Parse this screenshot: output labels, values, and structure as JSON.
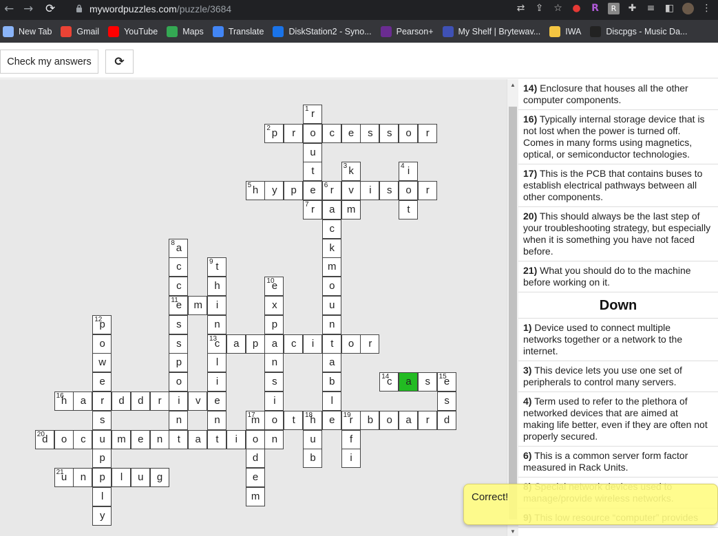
{
  "browser": {
    "url_host": "mywordpuzzles.com",
    "url_path": "/puzzle/3684",
    "bookmarks": [
      {
        "label": "New Tab",
        "color": "#8ab4f8"
      },
      {
        "label": "Gmail",
        "color": "#ea4335"
      },
      {
        "label": "YouTube",
        "color": "#ff0000"
      },
      {
        "label": "Maps",
        "color": "#34a853"
      },
      {
        "label": "Translate",
        "color": "#4285f4"
      },
      {
        "label": "DiskStation2 - Syno...",
        "color": "#1a73e8"
      },
      {
        "label": "Pearson+",
        "color": "#6a2c91"
      },
      {
        "label": "My Shelf | Brytewav...",
        "color": "#3f51b5"
      },
      {
        "label": "IWA",
        "color": "#f4c542"
      },
      {
        "label": "Discpgs - Music Da...",
        "color": "#222222"
      }
    ]
  },
  "toolbar": {
    "check_label": "Check my answers",
    "refresh_icon": "⟳"
  },
  "grid": {
    "highlight_color": "#22bb22",
    "cells": [
      {
        "c": 15,
        "r": 1,
        "l": "r",
        "n": "1"
      },
      {
        "c": 13,
        "r": 2,
        "l": "p",
        "n": "2"
      },
      {
        "c": 14,
        "r": 2,
        "l": "r"
      },
      {
        "c": 15,
        "r": 2,
        "l": "o"
      },
      {
        "c": 16,
        "r": 2,
        "l": "c"
      },
      {
        "c": 17,
        "r": 2,
        "l": "e"
      },
      {
        "c": 18,
        "r": 2,
        "l": "s"
      },
      {
        "c": 19,
        "r": 2,
        "l": "s"
      },
      {
        "c": 20,
        "r": 2,
        "l": "o"
      },
      {
        "c": 21,
        "r": 2,
        "l": "r"
      },
      {
        "c": 15,
        "r": 3,
        "l": "u"
      },
      {
        "c": 15,
        "r": 4,
        "l": "t"
      },
      {
        "c": 17,
        "r": 4,
        "l": "k",
        "n": "3"
      },
      {
        "c": 20,
        "r": 4,
        "l": "i",
        "n": "4"
      },
      {
        "c": 12,
        "r": 5,
        "l": "h",
        "n": "5"
      },
      {
        "c": 13,
        "r": 5,
        "l": "y"
      },
      {
        "c": 14,
        "r": 5,
        "l": "p"
      },
      {
        "c": 15,
        "r": 5,
        "l": "e"
      },
      {
        "c": 16,
        "r": 5,
        "l": "r",
        "n": "6"
      },
      {
        "c": 17,
        "r": 5,
        "l": "v"
      },
      {
        "c": 18,
        "r": 5,
        "l": "i"
      },
      {
        "c": 19,
        "r": 5,
        "l": "s"
      },
      {
        "c": 20,
        "r": 5,
        "l": "o"
      },
      {
        "c": 21,
        "r": 5,
        "l": "r"
      },
      {
        "c": 15,
        "r": 6,
        "l": "r",
        "n": "7"
      },
      {
        "c": 16,
        "r": 6,
        "l": "a"
      },
      {
        "c": 17,
        "r": 6,
        "l": "m"
      },
      {
        "c": 20,
        "r": 6,
        "l": "t"
      },
      {
        "c": 16,
        "r": 7,
        "l": "c"
      },
      {
        "c": 8,
        "r": 8,
        "l": "a",
        "n": "8"
      },
      {
        "c": 16,
        "r": 8,
        "l": "k"
      },
      {
        "c": 8,
        "r": 9,
        "l": "c"
      },
      {
        "c": 10,
        "r": 9,
        "l": "t",
        "n": "9"
      },
      {
        "c": 16,
        "r": 9,
        "l": "m"
      },
      {
        "c": 8,
        "r": 10,
        "l": "c"
      },
      {
        "c": 10,
        "r": 10,
        "l": "h"
      },
      {
        "c": 13,
        "r": 10,
        "l": "e",
        "n": "10"
      },
      {
        "c": 16,
        "r": 10,
        "l": "o"
      },
      {
        "c": 8,
        "r": 11,
        "l": "e",
        "n": "11"
      },
      {
        "c": 9,
        "r": 11,
        "l": "m"
      },
      {
        "c": 10,
        "r": 11,
        "l": "i"
      },
      {
        "c": 13,
        "r": 11,
        "l": "x"
      },
      {
        "c": 16,
        "r": 11,
        "l": "u"
      },
      {
        "c": 4,
        "r": 12,
        "l": "p",
        "n": "12"
      },
      {
        "c": 8,
        "r": 12,
        "l": "s"
      },
      {
        "c": 10,
        "r": 12,
        "l": "n"
      },
      {
        "c": 13,
        "r": 12,
        "l": "p"
      },
      {
        "c": 16,
        "r": 12,
        "l": "n"
      },
      {
        "c": 4,
        "r": 13,
        "l": "o"
      },
      {
        "c": 8,
        "r": 13,
        "l": "s"
      },
      {
        "c": 10,
        "r": 13,
        "l": "c",
        "n": "13"
      },
      {
        "c": 11,
        "r": 13,
        "l": "a"
      },
      {
        "c": 12,
        "r": 13,
        "l": "p"
      },
      {
        "c": 13,
        "r": 13,
        "l": "a"
      },
      {
        "c": 14,
        "r": 13,
        "l": "c"
      },
      {
        "c": 15,
        "r": 13,
        "l": "i"
      },
      {
        "c": 16,
        "r": 13,
        "l": "t"
      },
      {
        "c": 17,
        "r": 13,
        "l": "o"
      },
      {
        "c": 18,
        "r": 13,
        "l": "r"
      },
      {
        "c": 4,
        "r": 14,
        "l": "w"
      },
      {
        "c": 8,
        "r": 14,
        "l": "p"
      },
      {
        "c": 10,
        "r": 14,
        "l": "l"
      },
      {
        "c": 13,
        "r": 14,
        "l": "n"
      },
      {
        "c": 16,
        "r": 14,
        "l": "a"
      },
      {
        "c": 4,
        "r": 15,
        "l": "e"
      },
      {
        "c": 8,
        "r": 15,
        "l": "o"
      },
      {
        "c": 10,
        "r": 15,
        "l": "i"
      },
      {
        "c": 13,
        "r": 15,
        "l": "s"
      },
      {
        "c": 16,
        "r": 15,
        "l": "b"
      },
      {
        "c": 19,
        "r": 15,
        "l": "c",
        "n": "14"
      },
      {
        "c": 20,
        "r": 15,
        "l": "a",
        "hl": true
      },
      {
        "c": 21,
        "r": 15,
        "l": "s"
      },
      {
        "c": 22,
        "r": 15,
        "l": "e",
        "n": "15"
      },
      {
        "c": 2,
        "r": 16,
        "l": "h",
        "n": "16"
      },
      {
        "c": 3,
        "r": 16,
        "l": "a"
      },
      {
        "c": 4,
        "r": 16,
        "l": "r"
      },
      {
        "c": 5,
        "r": 16,
        "l": "d"
      },
      {
        "c": 6,
        "r": 16,
        "l": "d"
      },
      {
        "c": 7,
        "r": 16,
        "l": "r"
      },
      {
        "c": 8,
        "r": 16,
        "l": "i"
      },
      {
        "c": 9,
        "r": 16,
        "l": "v"
      },
      {
        "c": 10,
        "r": 16,
        "l": "e"
      },
      {
        "c": 13,
        "r": 16,
        "l": "i"
      },
      {
        "c": 16,
        "r": 16,
        "l": "l"
      },
      {
        "c": 22,
        "r": 16,
        "l": "s"
      },
      {
        "c": 4,
        "r": 17,
        "l": "s"
      },
      {
        "c": 8,
        "r": 17,
        "l": "n"
      },
      {
        "c": 10,
        "r": 17,
        "l": "n"
      },
      {
        "c": 12,
        "r": 17,
        "l": "m",
        "n": "17"
      },
      {
        "c": 13,
        "r": 17,
        "l": "o"
      },
      {
        "c": 14,
        "r": 17,
        "l": "t"
      },
      {
        "c": 15,
        "r": 17,
        "l": "h",
        "n": "18"
      },
      {
        "c": 16,
        "r": 17,
        "l": "e"
      },
      {
        "c": 17,
        "r": 17,
        "l": "r",
        "n": "19"
      },
      {
        "c": 18,
        "r": 17,
        "l": "b"
      },
      {
        "c": 19,
        "r": 17,
        "l": "o"
      },
      {
        "c": 20,
        "r": 17,
        "l": "a"
      },
      {
        "c": 21,
        "r": 17,
        "l": "r"
      },
      {
        "c": 22,
        "r": 17,
        "l": "d"
      },
      {
        "c": 1,
        "r": 18,
        "l": "d",
        "n": "20"
      },
      {
        "c": 2,
        "r": 18,
        "l": "o"
      },
      {
        "c": 3,
        "r": 18,
        "l": "c"
      },
      {
        "c": 4,
        "r": 18,
        "l": "u"
      },
      {
        "c": 5,
        "r": 18,
        "l": "m"
      },
      {
        "c": 6,
        "r": 18,
        "l": "e"
      },
      {
        "c": 7,
        "r": 18,
        "l": "n"
      },
      {
        "c": 8,
        "r": 18,
        "l": "t"
      },
      {
        "c": 9,
        "r": 18,
        "l": "a"
      },
      {
        "c": 10,
        "r": 18,
        "l": "t"
      },
      {
        "c": 11,
        "r": 18,
        "l": "i"
      },
      {
        "c": 12,
        "r": 18,
        "l": "o"
      },
      {
        "c": 13,
        "r": 18,
        "l": "n"
      },
      {
        "c": 15,
        "r": 18,
        "l": "u"
      },
      {
        "c": 17,
        "r": 18,
        "l": "f"
      },
      {
        "c": 4,
        "r": 19,
        "l": "p"
      },
      {
        "c": 12,
        "r": 19,
        "l": "d"
      },
      {
        "c": 15,
        "r": 19,
        "l": "b"
      },
      {
        "c": 17,
        "r": 19,
        "l": "i"
      },
      {
        "c": 2,
        "r": 20,
        "l": "u",
        "n": "21"
      },
      {
        "c": 3,
        "r": 20,
        "l": "n"
      },
      {
        "c": 4,
        "r": 20,
        "l": "p"
      },
      {
        "c": 5,
        "r": 20,
        "l": "l"
      },
      {
        "c": 6,
        "r": 20,
        "l": "u"
      },
      {
        "c": 7,
        "r": 20,
        "l": "g"
      },
      {
        "c": 12,
        "r": 20,
        "l": "e"
      },
      {
        "c": 4,
        "r": 21,
        "l": "l"
      },
      {
        "c": 12,
        "r": 21,
        "l": "m"
      },
      {
        "c": 4,
        "r": 22,
        "l": "y"
      }
    ]
  },
  "clues": {
    "across_items": [
      {
        "num": "14)",
        "text": "Enclosure that houses all the other computer components."
      },
      {
        "num": "16)",
        "text": "Typically internal storage device that is not lost when the power is turned off. Comes in many forms using magnetics, optical, or semiconductor technologies."
      },
      {
        "num": "17)",
        "text": "This is the PCB that contains buses to establish electrical pathways between all other components."
      },
      {
        "num": "20)",
        "text": "This should always be the last step of your troubleshooting strategy, but especially when it is something you have not faced before."
      },
      {
        "num": "21)",
        "text": "What you should do to the machine before working on it."
      }
    ],
    "down_heading": "Down",
    "down_items": [
      {
        "num": "1)",
        "text": "Device used to connect multiple networks together or a network to the internet."
      },
      {
        "num": "3)",
        "text": "This device lets you use one set of peripherals to control many servers."
      },
      {
        "num": "4)",
        "text": "Term used to refer to the plethora of networked devices that are aimed at making life better, even if they are often not properly secured."
      },
      {
        "num": "6)",
        "text": "This is a common server form factor measured in Rack Units."
      },
      {
        "num": "8)",
        "text": "Special network devices used to manage/provide wireless networks."
      },
      {
        "num": "9)",
        "text": "This low resource “computer” provides"
      }
    ]
  },
  "toast": {
    "text": "Correct!",
    "color": "#fffc82"
  }
}
